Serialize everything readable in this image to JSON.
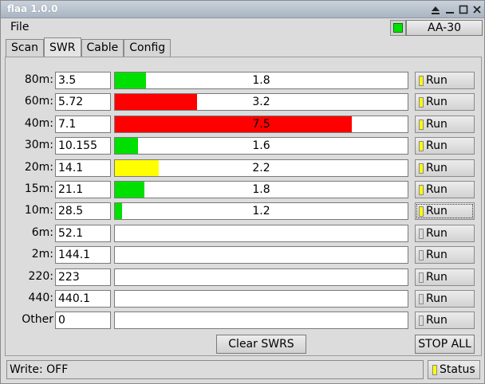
{
  "window": {
    "title": "flaa 1.0.0"
  },
  "menu": {
    "file": "File",
    "device": "AA-30",
    "device_led_color": "#00e000"
  },
  "tabs": [
    "Scan",
    "SWR",
    "Cable",
    "Config"
  ],
  "active_tab": "SWR",
  "bands": [
    {
      "label": "80m:",
      "freq": "3.5",
      "swr": "1.8",
      "level": 0.105,
      "color": "#00e000",
      "run_led": "#ffff00"
    },
    {
      "label": "60m:",
      "freq": "5.72",
      "swr": "3.2",
      "level": 0.28,
      "color": "#ff0000",
      "run_led": "#ffff00"
    },
    {
      "label": "40m:",
      "freq": "7.1",
      "swr": "7.5",
      "level": 0.81,
      "color": "#ff0000",
      "run_led": "#ffff00"
    },
    {
      "label": "30m:",
      "freq": "10.155",
      "swr": "1.6",
      "level": 0.08,
      "color": "#00e000",
      "run_led": "#ffff00"
    },
    {
      "label": "20m:",
      "freq": "14.1",
      "swr": "2.2",
      "level": 0.15,
      "color": "#ffff00",
      "run_led": "#ffff00"
    },
    {
      "label": "15m:",
      "freq": "21.1",
      "swr": "1.8",
      "level": 0.1,
      "color": "#00e000",
      "run_led": "#ffff00"
    },
    {
      "label": "10m:",
      "freq": "28.5",
      "swr": "1.2",
      "level": 0.025,
      "color": "#00e000",
      "run_led": "#ffff00"
    },
    {
      "label": "6m:",
      "freq": "52.1",
      "swr": "",
      "level": 0,
      "color": "#00e000",
      "run_led": "#dcdcdc"
    },
    {
      "label": "2m:",
      "freq": "144.1",
      "swr": "",
      "level": 0,
      "color": "#00e000",
      "run_led": "#dcdcdc"
    },
    {
      "label": "220:",
      "freq": "223",
      "swr": "",
      "level": 0,
      "color": "#00e000",
      "run_led": "#dcdcdc"
    },
    {
      "label": "440:",
      "freq": "440.1",
      "swr": "",
      "level": 0,
      "color": "#00e000",
      "run_led": "#dcdcdc"
    },
    {
      "label": "Other",
      "freq": "0",
      "swr": "",
      "level": 0,
      "color": "#00e000",
      "run_led": "#dcdcdc"
    }
  ],
  "run_label": "Run",
  "buttons": {
    "clear": "Clear SWRS",
    "stop_all": "STOP ALL"
  },
  "status": {
    "text": "Write: OFF",
    "button": "Status",
    "led_color": "#ffff00"
  }
}
